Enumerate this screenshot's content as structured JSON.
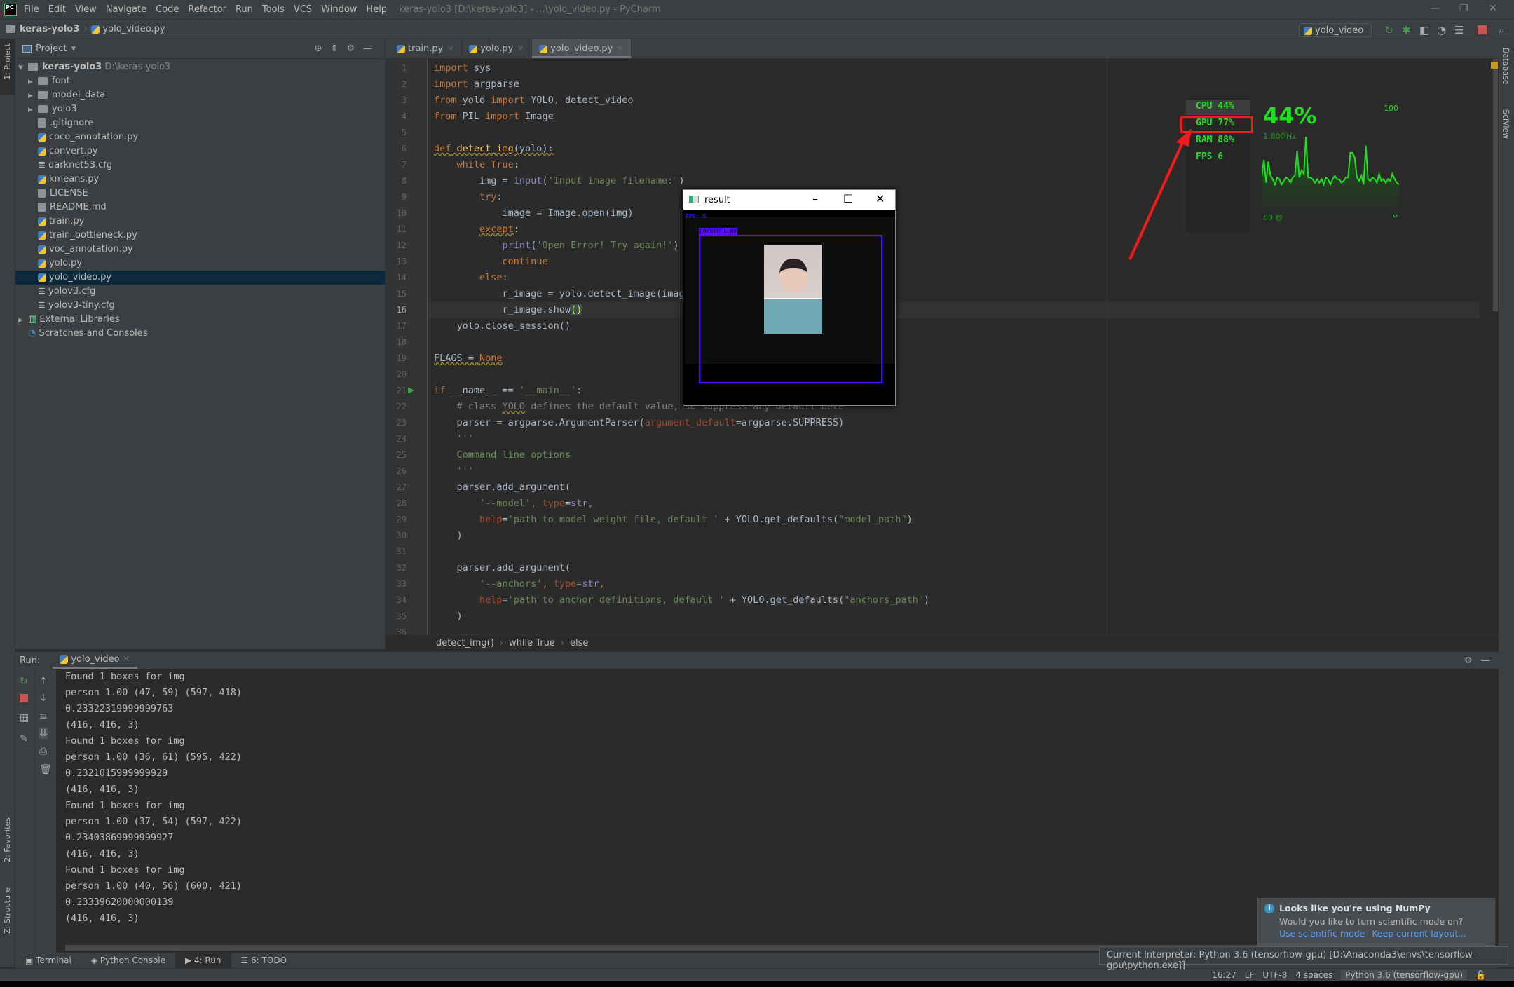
{
  "app": {
    "logo": "PC",
    "menu": [
      "File",
      "Edit",
      "View",
      "Navigate",
      "Code",
      "Refactor",
      "Run",
      "Tools",
      "VCS",
      "Window",
      "Help"
    ],
    "title": "keras-yolo3 [D:\\keras-yolo3] - ...\\yolo_video.py - PyCharm"
  },
  "nav": {
    "project": "keras-yolo3",
    "file": "yolo_video.py"
  },
  "toolbar": {
    "run_config": "yolo_video"
  },
  "left_strip": {
    "project": "1: Project",
    "favorites": "2: Favorites",
    "structure": "Z: Structure"
  },
  "right_strip": {
    "database": "Database",
    "sciview": "SciView"
  },
  "project": {
    "header": "Project",
    "root": "keras-yolo3",
    "root_path": "D:\\keras-yolo3",
    "items": [
      {
        "label": "font",
        "type": "folder",
        "depth": 1
      },
      {
        "label": "model_data",
        "type": "folder",
        "depth": 1
      },
      {
        "label": "yolo3",
        "type": "folder",
        "depth": 1
      },
      {
        "label": ".gitignore",
        "type": "file",
        "depth": 1
      },
      {
        "label": "coco_annotation.py",
        "type": "py",
        "depth": 1
      },
      {
        "label": "convert.py",
        "type": "py",
        "depth": 1
      },
      {
        "label": "darknet53.cfg",
        "type": "cfg",
        "depth": 1
      },
      {
        "label": "kmeans.py",
        "type": "py",
        "depth": 1
      },
      {
        "label": "LICENSE",
        "type": "file",
        "depth": 1
      },
      {
        "label": "README.md",
        "type": "md",
        "depth": 1
      },
      {
        "label": "train.py",
        "type": "py",
        "depth": 1
      },
      {
        "label": "train_bottleneck.py",
        "type": "py",
        "depth": 1
      },
      {
        "label": "voc_annotation.py",
        "type": "py",
        "depth": 1
      },
      {
        "label": "yolo.py",
        "type": "py",
        "depth": 1
      },
      {
        "label": "yolo_video.py",
        "type": "py",
        "depth": 1,
        "selected": true
      },
      {
        "label": "yolov3.cfg",
        "type": "cfg",
        "depth": 1
      },
      {
        "label": "yolov3-tiny.cfg",
        "type": "cfg",
        "depth": 1
      },
      {
        "label": "External Libraries",
        "type": "lib",
        "depth": 0
      },
      {
        "label": "Scratches and Consoles",
        "type": "scratch",
        "depth": 0
      }
    ]
  },
  "tabs": [
    {
      "label": "train.py"
    },
    {
      "label": "yolo.py"
    },
    {
      "label": "yolo_video.py",
      "active": true
    }
  ],
  "editor": {
    "current_line": 16,
    "lines": [
      [
        [
          "k",
          "import"
        ],
        [
          "t",
          " sys"
        ]
      ],
      [
        [
          "k",
          "import"
        ],
        [
          "t",
          " argparse"
        ]
      ],
      [
        [
          "k",
          "from"
        ],
        [
          "t",
          " yolo "
        ],
        [
          "k",
          "import"
        ],
        [
          "t",
          " YOLO"
        ],
        [
          "k",
          ","
        ],
        [
          "t",
          " detect_video"
        ]
      ],
      [
        [
          "k",
          "from"
        ],
        [
          "t",
          " PIL "
        ],
        [
          "k",
          "import"
        ],
        [
          "t",
          " Image"
        ]
      ],
      [],
      [
        [
          "k u",
          "def"
        ],
        [
          "f u",
          " detect_img"
        ],
        [
          "t u",
          "(yolo):"
        ]
      ],
      [
        [
          "t",
          "    "
        ],
        [
          "k",
          "while True"
        ],
        [
          "t",
          ":"
        ]
      ],
      [
        [
          "t",
          "        img = "
        ],
        [
          "b",
          "input"
        ],
        [
          "t",
          "("
        ],
        [
          "s",
          "'Input image filename:'"
        ],
        [
          "t",
          ")"
        ]
      ],
      [
        [
          "t",
          "        "
        ],
        [
          "k",
          "try"
        ],
        [
          "t",
          ":"
        ]
      ],
      [
        [
          "t",
          "            image = Image.open(img)"
        ]
      ],
      [
        [
          "t",
          "        "
        ],
        [
          "k u",
          "except"
        ],
        [
          "t",
          ":"
        ]
      ],
      [
        [
          "t",
          "            "
        ],
        [
          "b",
          "print"
        ],
        [
          "t",
          "("
        ],
        [
          "s",
          "'Open Error! Try again!'"
        ],
        [
          "t",
          ")"
        ]
      ],
      [
        [
          "t",
          "            "
        ],
        [
          "k",
          "continue"
        ]
      ],
      [
        [
          "t",
          "        "
        ],
        [
          "k",
          "else"
        ],
        [
          "t",
          ":"
        ]
      ],
      [
        [
          "t",
          "            r_image = yolo.detect_image(image)"
        ]
      ],
      [
        [
          "t",
          "            r_image.show"
        ],
        [
          "hl",
          "()"
        ]
      ],
      [
        [
          "t",
          "    yolo.close_session()"
        ]
      ],
      [],
      [
        [
          "t u",
          "FLAGS = "
        ],
        [
          "k u",
          "None"
        ]
      ],
      [],
      [
        [
          "k",
          "if"
        ],
        [
          "t",
          " __name__ == "
        ],
        [
          "s",
          "'__main__'"
        ],
        [
          "t",
          ":"
        ]
      ],
      [
        [
          "c",
          "    # class "
        ],
        [
          "c u",
          "YOLO"
        ],
        [
          "c",
          " defines the default value, so suppress any default here"
        ]
      ],
      [
        [
          "t",
          "    parser = argparse.ArgumentParser("
        ],
        [
          "p",
          "argument_default"
        ],
        [
          "t",
          "=argparse.SUPPRESS)"
        ]
      ],
      [
        [
          "d",
          "    '''"
        ]
      ],
      [
        [
          "d",
          "    Command line options"
        ]
      ],
      [
        [
          "d",
          "    '''"
        ]
      ],
      [
        [
          "t",
          "    parser.add_argument("
        ]
      ],
      [
        [
          "s",
          "        '--model'"
        ],
        [
          "k",
          ", "
        ],
        [
          "p",
          "type"
        ],
        [
          "t",
          "="
        ],
        [
          "b",
          "str"
        ],
        [
          "k",
          ","
        ]
      ],
      [
        [
          "p",
          "        help"
        ],
        [
          "t",
          "="
        ],
        [
          "s",
          "'path to model weight file, default '"
        ],
        [
          "t",
          " + YOLO.get_defaults("
        ],
        [
          "s",
          "\"model_path\""
        ],
        [
          "t",
          ")"
        ]
      ],
      [
        [
          "t",
          "    )"
        ]
      ],
      [],
      [
        [
          "t",
          "    parser.add_argument("
        ]
      ],
      [
        [
          "s",
          "        '--anchors'"
        ],
        [
          "k",
          ", "
        ],
        [
          "p",
          "type"
        ],
        [
          "t",
          "="
        ],
        [
          "b",
          "str"
        ],
        [
          "k",
          ","
        ]
      ],
      [
        [
          "p",
          "        help"
        ],
        [
          "t",
          "="
        ],
        [
          "s",
          "'path to anchor definitions, default '"
        ],
        [
          "t",
          " + YOLO.get_defaults("
        ],
        [
          "s",
          "\"anchors_path\""
        ],
        [
          "t",
          ")"
        ]
      ],
      [
        [
          "t",
          "    )"
        ]
      ],
      []
    ]
  },
  "breadcrumb": [
    "detect_img()",
    "while True",
    "else"
  ],
  "run": {
    "label": "Run:",
    "tab": "yolo_video",
    "output": [
      "Found 1 boxes for img",
      "person 1.00 (47, 59) (597, 418)",
      "0.23322319999999763",
      "(416, 416, 3)",
      "Found 1 boxes for img",
      "person 1.00 (36, 61) (595, 422)",
      "0.2321015999999929",
      "(416, 416, 3)",
      "Found 1 boxes for img",
      "person 1.00 (37, 54) (597, 422)",
      "0.23403869999999927",
      "(416, 416, 3)",
      "Found 1 boxes for img",
      "person 1.00 (40, 56) (600, 421)",
      "0.23339620000000139",
      "(416, 416, 3)"
    ]
  },
  "result_window": {
    "title": "result",
    "fps_label": "FPS: 5",
    "box_label": "person 1.00",
    "box_color": "#5b0cff"
  },
  "monitor": {
    "cpu": "CPU  44%",
    "gpu": "GPU  77%",
    "ram": "RAM  88%",
    "fps": "FPS   6",
    "big": "44%",
    "freq": "1.80GHz",
    "max": "100",
    "min": "0",
    "span": "60 秒",
    "accent": "#1ee11e",
    "cpu_history": [
      42,
      62,
      36,
      60,
      44,
      40,
      34,
      42,
      40,
      34,
      38,
      42,
      40,
      36,
      42,
      44,
      72,
      42,
      50,
      46,
      88,
      42,
      42,
      40,
      36,
      40,
      36,
      40,
      34,
      42,
      40,
      34,
      40,
      44,
      40,
      40,
      36,
      38,
      42,
      42,
      70,
      70,
      64,
      42,
      38,
      44,
      34,
      78,
      40,
      38,
      42,
      40,
      36,
      46,
      38,
      40,
      36,
      40,
      38,
      46,
      40,
      36,
      34
    ]
  },
  "bottom_tabs": [
    {
      "label": "Terminal"
    },
    {
      "label": "Python Console"
    },
    {
      "label": "4: Run",
      "active": true
    },
    {
      "label": "6: TODO"
    }
  ],
  "tooltip": "Current Interpreter: Python 3.6 (tensorflow-gpu) [D:\\Anaconda3\\envs\\tensorflow-gpu\\python.exe]]",
  "notification": {
    "title": "Looks like you're using NumPy",
    "body": "Would you like to turn scientific mode on?",
    "action1": "Use scientific mode",
    "action2": "Keep current layout..."
  },
  "status": {
    "position": "16:27",
    "line_sep": "LF",
    "encoding": "UTF-8",
    "indent": "4 spaces",
    "interpreter": "Python 3.6 (tensorflow-gpu)"
  }
}
